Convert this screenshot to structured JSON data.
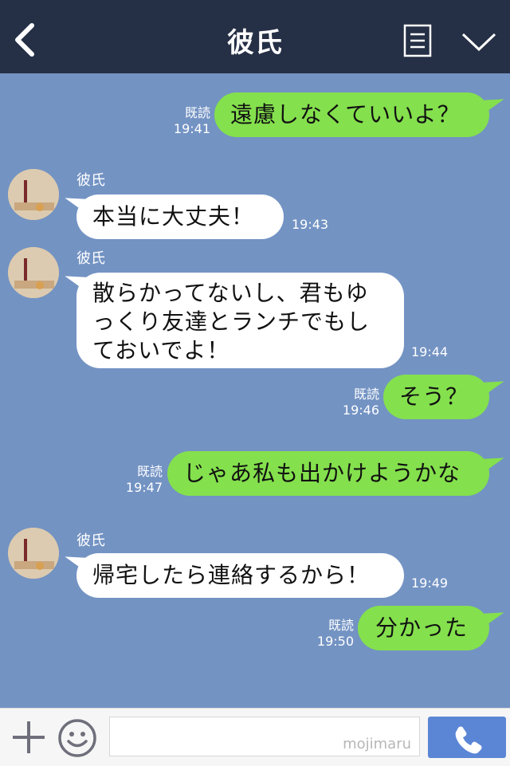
{
  "header": {
    "title": "彼氏"
  },
  "input": {
    "placeholder": "",
    "watermark": "mojimaru"
  },
  "messages": [
    {
      "text": "遠慮しなくていいよ？",
      "read": "既読",
      "time": "19:41"
    },
    {
      "sender": "彼氏",
      "text": "本当に大丈夫！",
      "time": "19:43"
    },
    {
      "sender": "彼氏",
      "lines": [
        "散らかってないし、君もゆ",
        "っくり友達とランチでもし",
        "ておいでよ！"
      ],
      "time": "19:44"
    },
    {
      "text": "そう？",
      "read": "既読",
      "time": "19:46"
    },
    {
      "text": "じゃあ私も出かけようかな",
      "read": "既読",
      "time": "19:47"
    },
    {
      "sender": "彼氏",
      "text": "帰宅したら連絡するから！",
      "time": "19:49"
    },
    {
      "text": "分かった",
      "read": "既読",
      "time": "19:50"
    }
  ],
  "colors": {
    "header": "#252f45",
    "background": "#7393c3",
    "my_bubble": "#84e04d",
    "their_bubble": "#ffffff",
    "send_button": "#5b86d6"
  },
  "icons": [
    "back-chevron-icon",
    "menu-list-icon",
    "dropdown-chevron-icon",
    "plus-icon",
    "smiley-icon",
    "phone-icon"
  ]
}
